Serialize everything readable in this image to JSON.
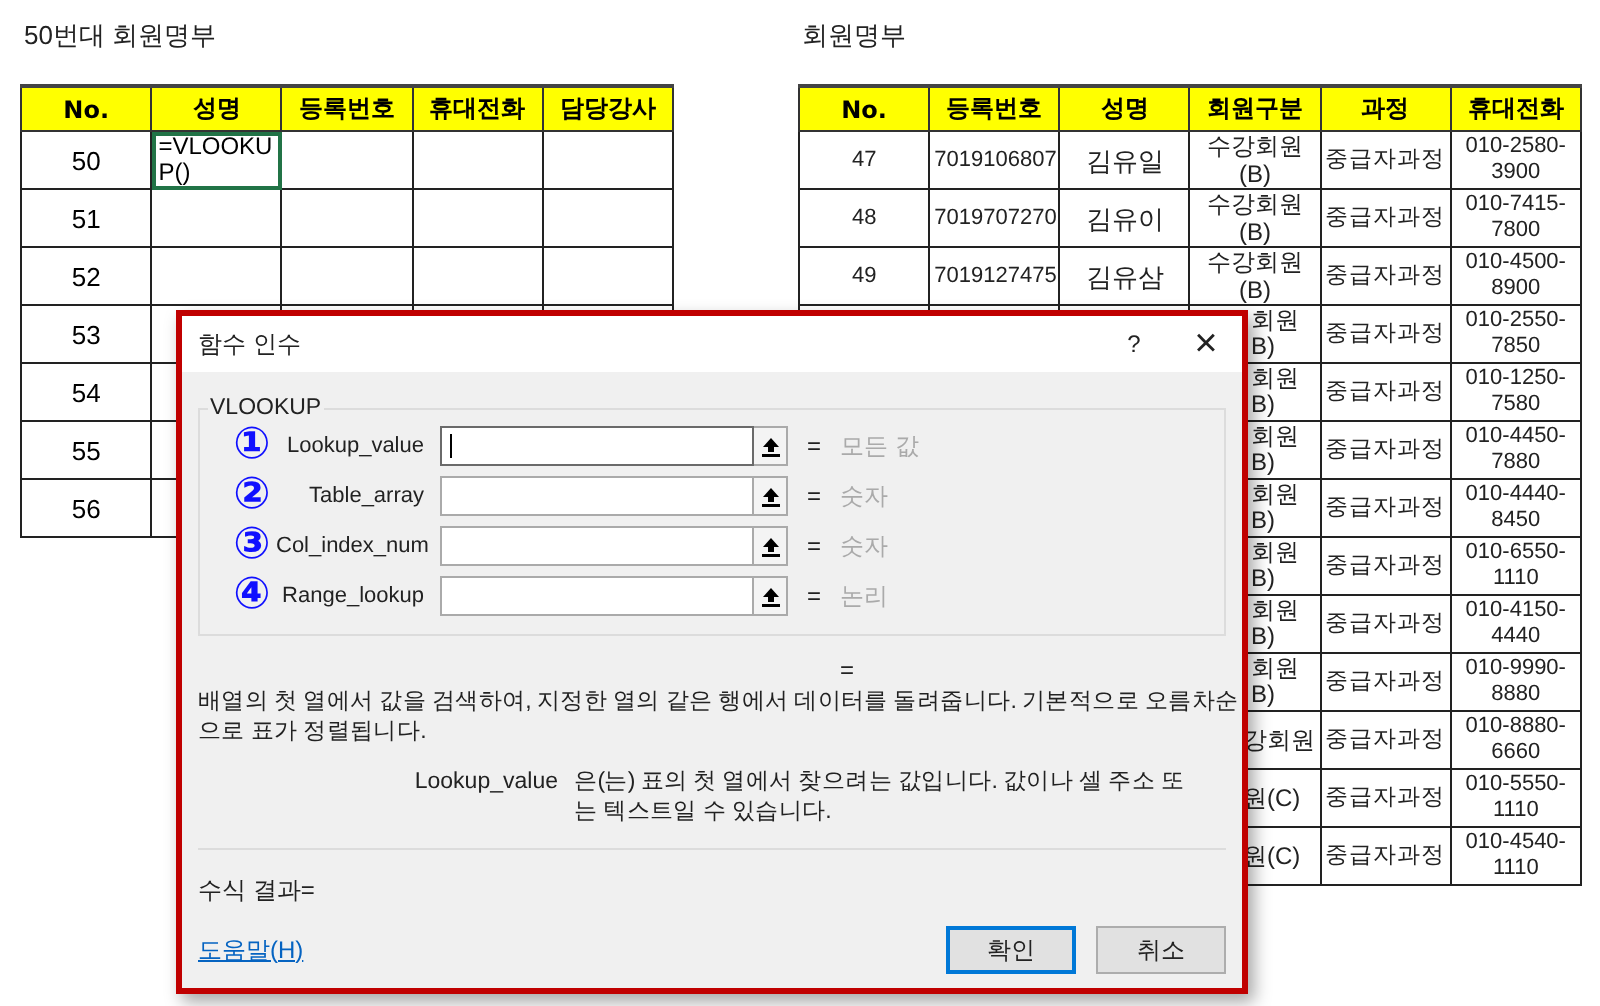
{
  "left_sheet": {
    "title": "50번대 회원명부",
    "columns": [
      "No.",
      "성명",
      "등록번호",
      "휴대전화",
      "담당강사"
    ],
    "rows": [
      {
        "no": "50",
        "name": "=VLOOKUP()",
        "selected": true
      },
      {
        "no": "51",
        "selected": false
      },
      {
        "no": "52",
        "selected": false
      },
      {
        "no": "53",
        "selected": false
      },
      {
        "no": "54",
        "selected": false
      },
      {
        "no": "55",
        "selected": false
      },
      {
        "no": "56",
        "selected": false
      }
    ]
  },
  "right_sheet": {
    "title": "회원명부",
    "columns": [
      "No.",
      "등록번호",
      "성명",
      "회원구분",
      "과정",
      "휴대전화"
    ],
    "rows": [
      {
        "kind": "full",
        "no": "47",
        "reg": "7019106807",
        "name": "김유일",
        "type": "수강회원 (B)",
        "course": "중급자과정",
        "phone": "010-2580-3900"
      },
      {
        "kind": "full",
        "no": "48",
        "reg": "7019707270",
        "name": "김유이",
        "type": "수강회원 (B)",
        "course": "중급자과정",
        "phone": "010-7415-7800"
      },
      {
        "kind": "full",
        "no": "49",
        "reg": "7019127475",
        "name": "김유삼",
        "type": "수강회원 (B)",
        "course": "중급자과정",
        "phone": "010-4500-8900"
      },
      {
        "kind": "covered",
        "type": "회원 B)",
        "course": "중급자과정",
        "phone": "010-2550-7850"
      },
      {
        "kind": "covered",
        "type": "회원 B)",
        "course": "중급자과정",
        "phone": "010-1250-7580"
      },
      {
        "kind": "covered",
        "type": "회원 B)",
        "course": "중급자과정",
        "phone": "010-4450-7880"
      },
      {
        "kind": "covered",
        "type": "회원 B)",
        "course": "중급자과정",
        "phone": "010-4440-8450"
      },
      {
        "kind": "covered",
        "type": "회원 B)",
        "course": "중급자과정",
        "phone": "010-6550-1110"
      },
      {
        "kind": "covered",
        "type": "회원 B)",
        "course": "중급자과정",
        "phone": "010-4150-4440"
      },
      {
        "kind": "covered",
        "type": "회원 B)",
        "course": "중급자과정",
        "phone": "010-9990-8880"
      },
      {
        "kind": "covered",
        "type": "강회원",
        "course": "중급자과정",
        "phone": "010-8880-6660"
      },
      {
        "kind": "covered",
        "type": "원(C)",
        "course": "중급자과정",
        "phone": "010-5550-1110"
      },
      {
        "kind": "covered",
        "type": "원(C)",
        "course": "중급자과정",
        "phone": "010-4540-1110"
      }
    ]
  },
  "dialog": {
    "title": "함수 인수",
    "help_button": "?",
    "close_button": "×",
    "function_name": "VLOOKUP",
    "arguments": [
      {
        "number": "①",
        "name": "Lookup_value",
        "equals": "=",
        "hint": "모든 값",
        "focused": true
      },
      {
        "number": "②",
        "name": "Table_array",
        "equals": "=",
        "hint": "숫자",
        "focused": false
      },
      {
        "number": "③",
        "name": "Col_index_num",
        "equals": "=",
        "hint": "숫자",
        "focused": false
      },
      {
        "number": "④",
        "name": "Range_lookup",
        "equals": "=",
        "hint": "논리",
        "focused": false
      }
    ],
    "result_equals": "=",
    "description": "배열의 첫 열에서 값을 검색하여, 지정한 열의 같은 행에서 데이터를 돌려줍니다. 기본적으로 오름차순으로 표가 정렬됩니다.",
    "argument_help": {
      "name": "Lookup_value",
      "text": "은(는) 표의 첫 열에서 찾으려는 값입니다. 값이나 셀 주소 또는 텍스트일 수 있습니다."
    },
    "formula_result": "수식 결과=",
    "help_link": "도움말(H)",
    "buttons": [
      {
        "label": "확인",
        "default": true
      },
      {
        "label": "취소",
        "default": false
      }
    ]
  }
}
